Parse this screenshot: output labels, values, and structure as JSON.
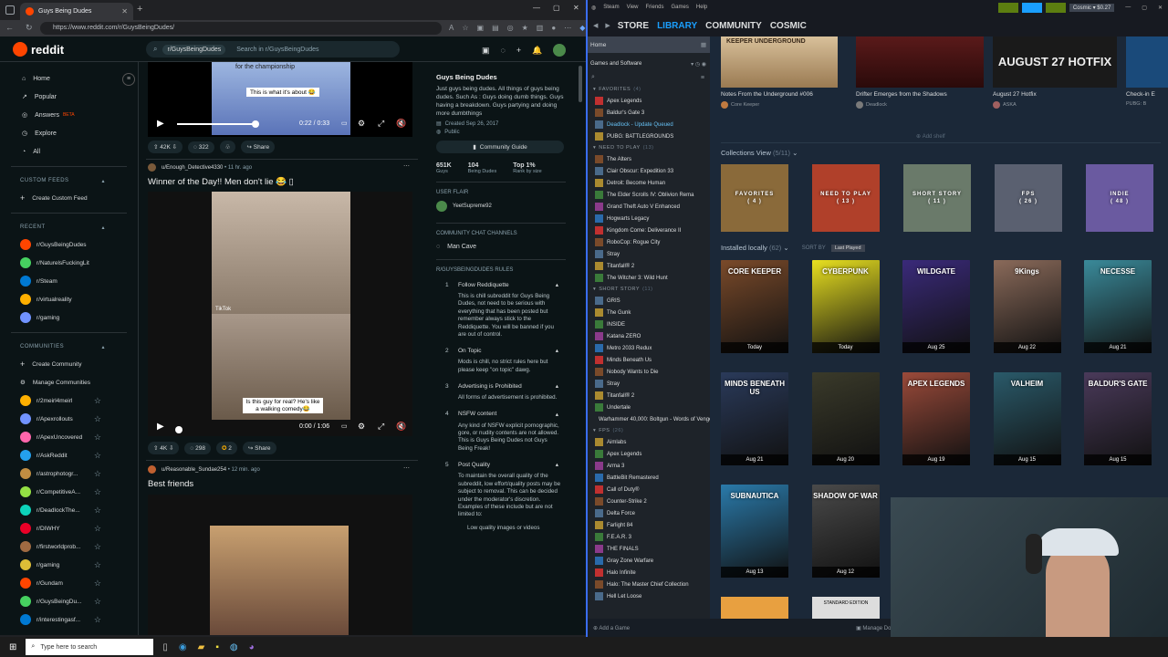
{
  "browser": {
    "tab_title": "Guys Being Dudes",
    "url": "https://www.reddit.com/r/GuysBeingDudes/"
  },
  "reddit": {
    "logo": "reddit",
    "search": {
      "chip": "r/GuysBeingDudes",
      "placeholder": "Search in r/GuysBeingDudes"
    },
    "nav": [
      {
        "label": "Home",
        "icon": "home-icon"
      },
      {
        "label": "Popular",
        "icon": "popular-icon"
      },
      {
        "label": "Answers",
        "badge": "BETA",
        "icon": "answers-icon"
      },
      {
        "label": "Explore",
        "icon": "explore-icon"
      },
      {
        "label": "All",
        "icon": "all-icon"
      }
    ],
    "custom_feeds_header": "CUSTOM FEEDS",
    "create_custom_feed": "Create Custom Feed",
    "recent_header": "RECENT",
    "recent": [
      "r/GuysBeingDudes",
      "r/NaturelsFuckingLit",
      "r/Steam",
      "r/virtualreality",
      "r/gaming"
    ],
    "communities_header": "COMMUNITIES",
    "create_community": "Create Community",
    "manage_communities": "Manage Communities",
    "communities": [
      "r/2meirl4meirl",
      "r/Apexrollouts",
      "r/ApexUncovered",
      "r/AskReddit",
      "r/astrophotogr...",
      "r/CompetitiveA...",
      "r/DeadlockThe...",
      "r/DIWHY",
      "r/firstworldprob...",
      "r/gaming",
      "r/Gundam",
      "r/GuysBeingDu...",
      "r/interestingasf..."
    ],
    "posts": [
      {
        "caption_top": "for the championship",
        "caption": "This is what it's about 😂",
        "time": "0:22 / 0:33",
        "votes": "42K",
        "comments": "322",
        "share": "Share"
      },
      {
        "author": "u/Enough_Detective4330",
        "age": "11 hr. ago",
        "title": "Winner of the Day!! Men don't lie 😂 ▯",
        "caption": "Is this guy for real? He's like a walking comedy😂",
        "time": "0:00 / 1:06",
        "votes": "4K",
        "comments": "298",
        "awards": "2",
        "share": "Share",
        "watermark": "TikTok"
      },
      {
        "author": "u/Reasonable_Sundae254",
        "age": "12 min. ago",
        "title": "Best friends"
      }
    ],
    "about": {
      "name": "Guys Being Dudes",
      "desc": "Just guys being dudes. All things of guys being dudes. Such As : Guys doing dumb things. Guys having a breakdown. Guys partying and doing more dumbthings",
      "created": "Created Sep 26, 2017",
      "public": "Public",
      "guide": "Community Guide",
      "stats": [
        {
          "v": "651K",
          "l": "Guys"
        },
        {
          "v": "104",
          "l": "Being Dudes"
        },
        {
          "v": "Top 1%",
          "l": "Rank by size"
        }
      ],
      "flair_header": "USER FLAIR",
      "flair_user": "YeetSupreme92",
      "chat_header": "COMMUNITY CHAT CHANNELS",
      "chat": "Man Cave",
      "rules_header": "R/GUYSBEINGDUDES RULES",
      "rules": [
        {
          "n": "1",
          "t": "Follow Reddiquette",
          "body": "This is chill subreddit for Guys Being Dudes, not need to be serious with everything that has been posted but remember always stick to the Reddiquette. You will be banned if you are out of control."
        },
        {
          "n": "2",
          "t": "On Topic",
          "body": "Mods is chill, no strict rules here but please keep \"on topic\" dawg."
        },
        {
          "n": "3",
          "t": "Advertising is Prohibited",
          "body": "All forms of advertisement is prohibited."
        },
        {
          "n": "4",
          "t": "NSFW content",
          "body": "Any kind of NSFW explicit pornographic, gore, or nudity contents are not allowed. This is Guys Being Dudes not Guys Being Freak!"
        },
        {
          "n": "5",
          "t": "Post Quality",
          "body": "To maintain the overall quality of the subreddit, low effort/quality posts may be subject to removal. This can be decided under the moderator's discretion. Examples of these include but are not limited to:"
        }
      ],
      "rule_bullet": "Low quality images or videos"
    }
  },
  "steam": {
    "menu": [
      "Steam",
      "View",
      "Friends",
      "Games",
      "Help"
    ],
    "wallet": "Cosmic ▾ $0.27",
    "nav": [
      "STORE",
      "LIBRARY",
      "COMMUNITY",
      "COSMIC"
    ],
    "home": "Home",
    "filter": "Games and Software",
    "categories": [
      {
        "name": "FAVORITES",
        "count": "(4)",
        "games": [
          "Apex Legends",
          "Baldur's Gate 3",
          "Deadlock - Update Queued",
          "PUBG: BATTLEGROUNDS"
        ]
      },
      {
        "name": "NEED TO PLAY",
        "count": "(13)",
        "games": [
          "The Alters",
          "Clair Obscur: Expedition 33",
          "Detroit: Become Human",
          "The Elder Scrolls IV: Oblivion Rema",
          "Grand Theft Auto V Enhanced",
          "Hogwarts Legacy",
          "Kingdom Come: Deliverance II",
          "RoboCop: Rogue City",
          "Stray",
          "Titanfall® 2",
          "The Witcher 3: Wild Hunt"
        ]
      },
      {
        "name": "SHORT STORY",
        "count": "(11)",
        "games": [
          "GRIS",
          "The Gunk",
          "INSIDE",
          "Katana ZERO",
          "Metro 2033 Redux",
          "Minds Beneath Us",
          "Nobody Wants to Die",
          "Stray",
          "Titanfall® 2",
          "Undertale",
          "Warhammer 40,000: Boltgun - Words of Vengeance"
        ]
      },
      {
        "name": "FPS",
        "count": "(26)",
        "games": [
          "Aimlabs",
          "Apex Legends",
          "Arma 3",
          "BattleBit Remastered",
          "Call of Duty®",
          "Counter-Strike 2",
          "Delta Force",
          "Farlight 84",
          "F.E.A.R. 3",
          "THE FINALS",
          "Gray Zone Warfare",
          "Halo Infinite",
          "Halo: The Master Chief Collection",
          "Hell Let Loose"
        ]
      }
    ],
    "add_game": "Add a Game",
    "manage_downloads": "Manage Downloads",
    "news": [
      {
        "title": "Notes From the Underground #006",
        "game": "Core Keeper"
      },
      {
        "title": "Drifter Emerges from the Shadows",
        "game": "Deadlock"
      },
      {
        "title": "August 27 Hotfix",
        "game": "ASKA",
        "art": "AUGUST 27 HOTFIX"
      },
      {
        "title": "Check-in E",
        "game": "PUBG: B"
      }
    ],
    "add_shelf": "Add shelf",
    "collections_label": "Collections View",
    "collections_count": "(5/11)",
    "collections": [
      {
        "name": "FAVORITES",
        "n": "( 4 )",
        "color": "#8a6a3a"
      },
      {
        "name": "NEED TO PLAY",
        "n": "( 13 )",
        "color": "#b0402a"
      },
      {
        "name": "SHORT STORY",
        "n": "( 11 )",
        "color": "#6a7a6a"
      },
      {
        "name": "FPS",
        "n": "( 26 )",
        "color": "#5a6070"
      },
      {
        "name": "INDIE",
        "n": "( 48 )",
        "color": "#6a5aa0"
      }
    ],
    "installed_label": "Installed locally",
    "installed_count": "(62)",
    "sort_by": "SORT BY",
    "sort_value": "Last Played",
    "tiles": [
      {
        "art": "CORE KEEPER",
        "label": "Today",
        "color": "#7a4a2a"
      },
      {
        "art": "CYBERPUNK",
        "label": "Today",
        "color": "#e8e020"
      },
      {
        "art": "WILDGATE",
        "label": "Aug 25",
        "color": "#3a2a7a"
      },
      {
        "art": "9Kings",
        "label": "Aug 22",
        "color": "#8a6a5a"
      },
      {
        "art": "NECESSE",
        "label": "Aug 21",
        "color": "#3a8a9a"
      },
      {
        "art": "MINDS BENEATH US",
        "label": "Aug 21",
        "color": "#2a3a5a"
      },
      {
        "art": "",
        "label": "Aug 20",
        "color": "#3a3a2a"
      },
      {
        "art": "APEX LEGENDS",
        "label": "Aug 19",
        "color": "#9a4a3a"
      },
      {
        "art": "VALHEIM",
        "label": "Aug 15",
        "color": "#2a5a6a"
      },
      {
        "art": "BALDUR'S GATE",
        "label": "Aug 15",
        "color": "#4a3a5a"
      },
      {
        "art": "SUBNAUTICA",
        "label": "Aug 13",
        "color": "#2a7aaa"
      },
      {
        "art": "SHADOW OF WAR",
        "label": "Aug 12",
        "color": "#4a4a4a"
      }
    ],
    "standard_edition": "STANDARD EDITION"
  },
  "taskbar": {
    "search_placeholder": "Type here to search"
  }
}
